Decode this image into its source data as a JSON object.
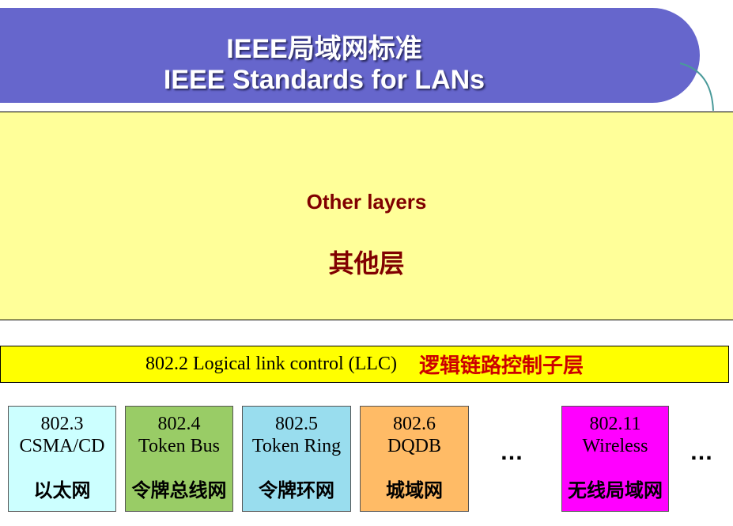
{
  "header": {
    "title_zh": "IEEE局域网标准",
    "title_en": "IEEE Standards for LANs"
  },
  "other_layers": {
    "label_en": "Other layers",
    "label_zh": "其他层"
  },
  "llc": {
    "label_en": "802.2  Logical link control (LLC)",
    "label_zh": "逻辑链路控制子层"
  },
  "standards": [
    {
      "number": "802.3",
      "name": "CSMA/CD",
      "label_zh": "以太网",
      "color": "#ccffff"
    },
    {
      "number": "802.4",
      "name": "Token Bus",
      "label_zh": "令牌总线网",
      "color": "#99cc66"
    },
    {
      "number": "802.5",
      "name": "Token Ring",
      "label_zh": "令牌环网",
      "color": "#99ddee"
    },
    {
      "number": "802.6",
      "name": "DQDB",
      "label_zh": "城域网",
      "color": "#ffbb66"
    },
    {
      "number": "802.11",
      "name": "Wireless",
      "label_zh": "无线局域网",
      "color": "#ff00ff"
    }
  ],
  "ellipsis": "…",
  "colors": {
    "header_bg": "#6666cc",
    "other_layers_bg": "#ffff99",
    "llc_bg": "#ffff00",
    "llc_zh_text": "#cc0000",
    "other_layers_text": "#800000"
  }
}
